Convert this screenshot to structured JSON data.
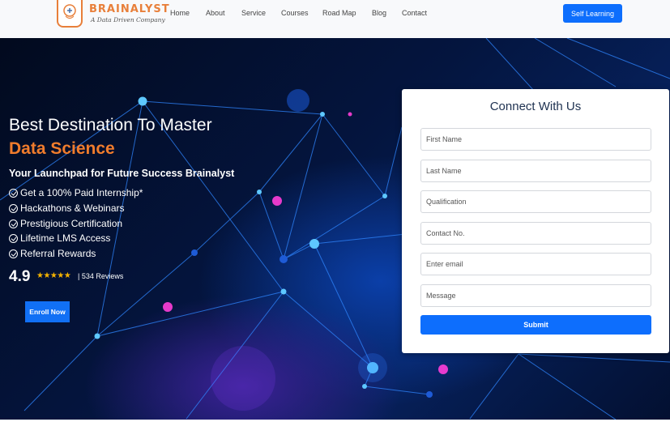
{
  "brand": {
    "name": "BRAINALYST",
    "tagline": "A Data Driven Company",
    "accent": "#e87f3a"
  },
  "nav": {
    "items": [
      {
        "label": "Home"
      },
      {
        "label": "About"
      },
      {
        "label": "Service"
      },
      {
        "label": "Courses"
      },
      {
        "label": "Road Map"
      },
      {
        "label": "Blog"
      },
      {
        "label": "Contact"
      }
    ],
    "cta_label": "Self Learning",
    "cta_color": "#0d6efd"
  },
  "hero": {
    "heading": "Best Destination To Master",
    "heading_accent": "Data Science",
    "accent_color": "#f07c2c",
    "subheading": "Your Launchpad for Future Success Brainalyst",
    "features": [
      {
        "label": "Get a 100% Paid Internship*"
      },
      {
        "label": "Hackathons & Webinars"
      },
      {
        "label": "Prestigious Certification"
      },
      {
        "label": "Lifetime LMS Access"
      },
      {
        "label": "Referral Rewards"
      }
    ],
    "rating": "4.9",
    "stars": "★★★★★",
    "reviews": "| 534 Reviews",
    "enroll_label": "Enroll Now"
  },
  "form": {
    "title": "Connect With Us",
    "fields": [
      {
        "placeholder": "First Name"
      },
      {
        "placeholder": "Last Name"
      },
      {
        "placeholder": "Qualification"
      },
      {
        "placeholder": "Contact No."
      },
      {
        "placeholder": "Enter email"
      },
      {
        "placeholder": "Message"
      }
    ],
    "submit_label": "Submit"
  }
}
